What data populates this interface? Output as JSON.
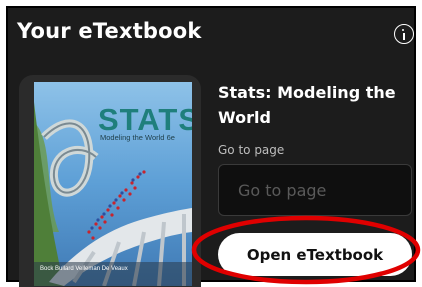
{
  "header": {
    "title": "Your eTextbook",
    "info_icon": "info-circle-icon"
  },
  "book": {
    "cover_title": "STATS",
    "cover_subtitle": "Modeling the World  6e",
    "cover_authors": "Bock   Bullard   Velleman   De Veaux",
    "title": "Stats: Modeling the World"
  },
  "goto": {
    "label": "Go to page",
    "placeholder": "Go to page"
  },
  "open_button": {
    "label": "Open eTextbook"
  },
  "colors": {
    "panel_bg": "#1c1c1c",
    "button_bg": "#ffffff",
    "highlight_ellipse": "#e00000"
  }
}
